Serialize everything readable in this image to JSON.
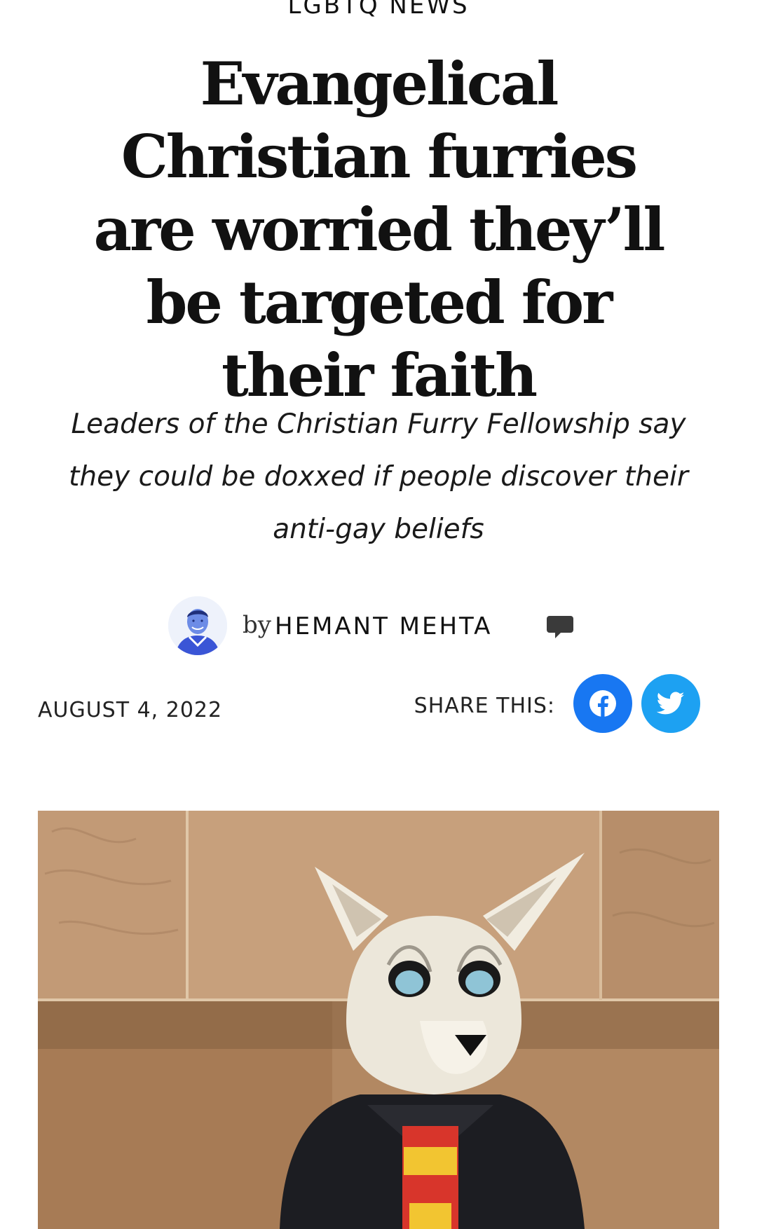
{
  "article": {
    "category": "LGBTQ NEWS",
    "headline": "Evangelical Christian furries are worried they’ll be targeted for their faith",
    "dek": "Leaders of the Christian Furry Fellowship say they could be doxxed if people discover their anti-gay beliefs",
    "byline": {
      "prefix": "by",
      "author": "HEMANT MEHTA"
    },
    "date": "AUGUST 4, 2022",
    "share": {
      "label": "SHARE THIS:",
      "buttons": [
        {
          "network": "facebook",
          "icon": "facebook-icon",
          "color": "#1877f2"
        },
        {
          "network": "twitter",
          "icon": "twitter-icon",
          "color": "#1da1f2"
        }
      ]
    }
  },
  "colors": {
    "text": "#111111",
    "facebook": "#1877f2",
    "twitter": "#1da1f2",
    "comment_icon": "#3a3a3a"
  },
  "icons": {
    "comment": "comment-icon",
    "avatar": "author-avatar"
  }
}
